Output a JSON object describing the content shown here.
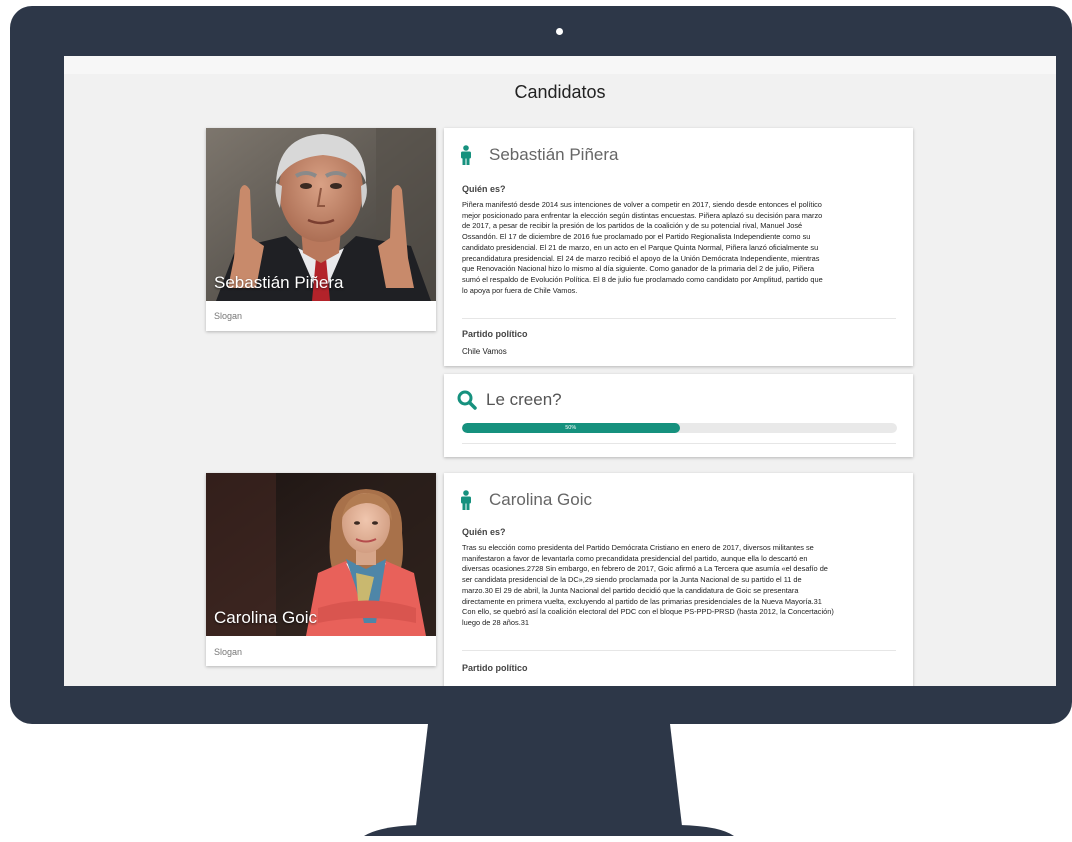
{
  "page": {
    "title": "Candidatos"
  },
  "colors": {
    "accent": "#16917e",
    "frame": "#2d3748",
    "screen_bg": "#f1f1f1"
  },
  "icons": {
    "person": "person-icon",
    "search": "search-icon"
  },
  "candidates": [
    {
      "name": "Sebastián Piñera",
      "slogan": "Slogan",
      "who_label": "Quién es?",
      "bio_lines": [
        "Piñera manifestó desde 2014 sus intenciones de volver a competir en 2017, siendo desde entonces el político",
        "mejor posicionado para enfrentar la elección según distintas encuestas. Piñera aplazó su decisión para marzo",
        "de 2017, a pesar de recibir la presión de los partidos de la coalición y de su potencial rival, Manuel José",
        "Ossandón. El 17 de diciembre de 2016 fue proclamado por el Partido Regionalista Independiente como su",
        "candidato presidencial. El 21 de marzo, en un acto en el Parque Quinta Normal, Piñera lanzó oficialmente su",
        "precandidatura presidencial. El 24 de marzo recibió el apoyo de la Unión Demócrata Independiente, mientras",
        "que Renovación Nacional hizo lo mismo al día siguiente. Como ganador de la primaria del 2 de julio, Piñera",
        "sumó el respaldo de Evolución Política. El 8 de julio fue proclamado como candidato por Amplitud, partido que",
        "lo apoya por fuera de Chile Vamos."
      ],
      "party_label": "Partido político",
      "party": "Chile Vamos",
      "belief_label": "Le creen?",
      "belief_percent": 50,
      "belief_text": "50%"
    },
    {
      "name": "Carolina Goic",
      "slogan": "Slogan",
      "who_label": "Quién es?",
      "bio_lines": [
        "Tras su elección como presidenta del Partido Demócrata Cristiano en enero de 2017, diversos militantes se",
        "manifestaron a favor de levantarla como precandidata presidencial del partido, aunque ella lo descartó en",
        "diversas ocasiones.2728 Sin embargo, en febrero de 2017, Goic afirmó a La Tercera que asumía «el desafío de",
        "ser candidata presidencial de la DC»,29 siendo proclamada por la Junta Nacional de su partido el 11 de",
        "marzo.30 El 29 de abril, la Junta Nacional del partido decidió que la candidatura de Goic se presentara",
        "directamente en primera vuelta, excluyendo al partido de las primarias presidenciales de la Nueva Mayoría.31",
        "Con ello, se quebró así la coalición electoral del PDC con el bloque PS-PPD-PRSD (hasta 2012, la Concertación)",
        "luego de 28 años.31"
      ],
      "party_label": "Partido político"
    }
  ]
}
